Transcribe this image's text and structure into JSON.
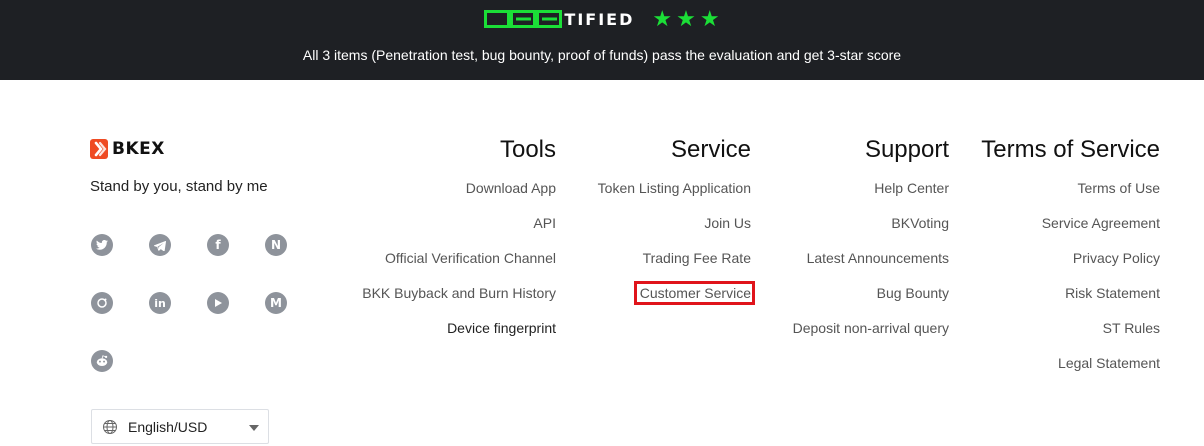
{
  "banner": {
    "cert_logo_text": "CER",
    "cert_word": "TIFIED",
    "star_count": 3,
    "description": "All 3 items (Penetration test, bug bounty, proof of funds) pass the evaluation and get 3-star score",
    "accent": "#1bdf37"
  },
  "brand": {
    "name": "BKEX",
    "slogan": "Stand by you, stand by me",
    "logo_color": "#ef4b23"
  },
  "social": [
    {
      "name": "twitter-icon"
    },
    {
      "name": "telegram-icon"
    },
    {
      "name": "facebook-icon"
    },
    {
      "name": "naver-icon"
    },
    {
      "name": "instagram-icon"
    },
    {
      "name": "linkedin-icon"
    },
    {
      "name": "youtube-icon"
    },
    {
      "name": "medium-icon"
    },
    {
      "name": "reddit-icon"
    }
  ],
  "language": {
    "label": "English/USD"
  },
  "columns": {
    "tools": {
      "title": "Tools",
      "links": [
        "Download App",
        "API",
        "Official Verification Channel",
        "BKK Buyback and Burn History",
        "Device fingerprint"
      ]
    },
    "service": {
      "title": "Service",
      "links": [
        "Token Listing Application",
        "Join Us",
        "Trading Fee Rate",
        "Customer Service"
      ]
    },
    "support": {
      "title": "Support",
      "links": [
        "Help Center",
        "BKVoting",
        "Latest Announcements",
        "Bug Bounty",
        "Deposit non-arrival query"
      ]
    },
    "terms": {
      "title": "Terms of Service",
      "links": [
        "Terms of Use",
        "Service Agreement",
        "Privacy Policy",
        "Risk Statement",
        "ST Rules",
        "Legal Statement"
      ]
    }
  },
  "highlight_color": "#e0141b"
}
